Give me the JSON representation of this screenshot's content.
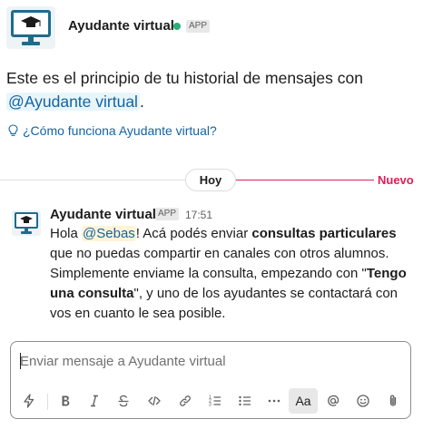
{
  "header": {
    "app_name": "Ayudante virtual",
    "app_badge": "APP",
    "presence": "online",
    "avatar_icon": "monitor-graduation-cap-icon"
  },
  "intro": {
    "text_before": "Este es el principio de tu historial de mensajes con ",
    "mention": "@Ayudante virtual",
    "text_after": ".",
    "help_link": "¿Cómo funciona Ayudante virtual?",
    "help_icon": "lightbulb-icon"
  },
  "divider": {
    "day": "Hoy",
    "new_label": "Nuevo"
  },
  "message": {
    "sender": "Ayudante virtual",
    "badge": "APP",
    "time": "17:51",
    "parts": {
      "p1": "Hola ",
      "mention": "@Sebas",
      "p2": "! Acá podés enviar ",
      "bold1": "consultas particulares",
      "p3": " que no puedas compartir en canales con otros alumnos. Simplemente enviame la consulta, empezando con \"",
      "bold2": "Tengo una consulta",
      "p4": "\", y uno de los ayudantes se contactará con vos en cuanto le sea posible."
    }
  },
  "composer": {
    "placeholder": "Enviar mensaje a Ayudante virtual",
    "value": "",
    "format_label": "Aa",
    "tools": [
      "lightning-icon",
      "bold-icon",
      "italic-icon",
      "strikethrough-icon",
      "code-icon",
      "link-icon",
      "ordered-list-icon",
      "bulleted-list-icon",
      "more-icon",
      "format-toggle",
      "mention-icon",
      "emoji-icon",
      "attachment-icon"
    ]
  },
  "colors": {
    "link": "#1264a3",
    "new_divider": "#e01e5a",
    "presence": "#2bac76",
    "avatar_accent": "#0b5a7a"
  }
}
